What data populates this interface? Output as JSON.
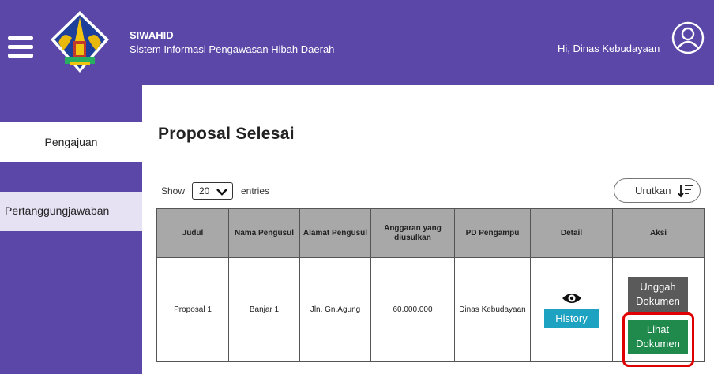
{
  "header": {
    "app_name": "SIWAHID",
    "app_subtitle": "Sistem Informasi Pengawasan Hibah Daerah",
    "greeting": "Hi, Dinas Kebudayaan"
  },
  "sidebar": {
    "items": [
      {
        "label": "Pengajuan"
      },
      {
        "label": "Pertanggungjawaban"
      }
    ]
  },
  "main": {
    "title": "Proposal Selesai",
    "show_label": "Show",
    "entries_value": "20",
    "entries_label": "entries",
    "sort_label": "Urutkan"
  },
  "table": {
    "columns": [
      "Judul",
      "Nama Pengusul",
      "Alamat Pengusul",
      "Anggaran yang diusulkan",
      "PD Pengampu",
      "Detail",
      "Aksi"
    ],
    "rows": [
      {
        "judul": "Proposal 1",
        "nama": "Banjar 1",
        "alamat": "Jln. Gn.Agung",
        "anggaran": "60.000.000",
        "pd": "Dinas Kebudayaan",
        "history_label": "History",
        "upload_label": "Unggah Dokumen",
        "view_label": "Lihat Dokumen"
      }
    ]
  },
  "colors": {
    "brand": "#5b47a8",
    "history": "#1da2c1",
    "upload": "#5a5a5a",
    "view": "#1f8a4c",
    "highlight": "#e00000"
  },
  "icons": [
    "hamburger-icon",
    "user-icon",
    "chevron-down-icon",
    "sort-icon",
    "eye-icon"
  ]
}
